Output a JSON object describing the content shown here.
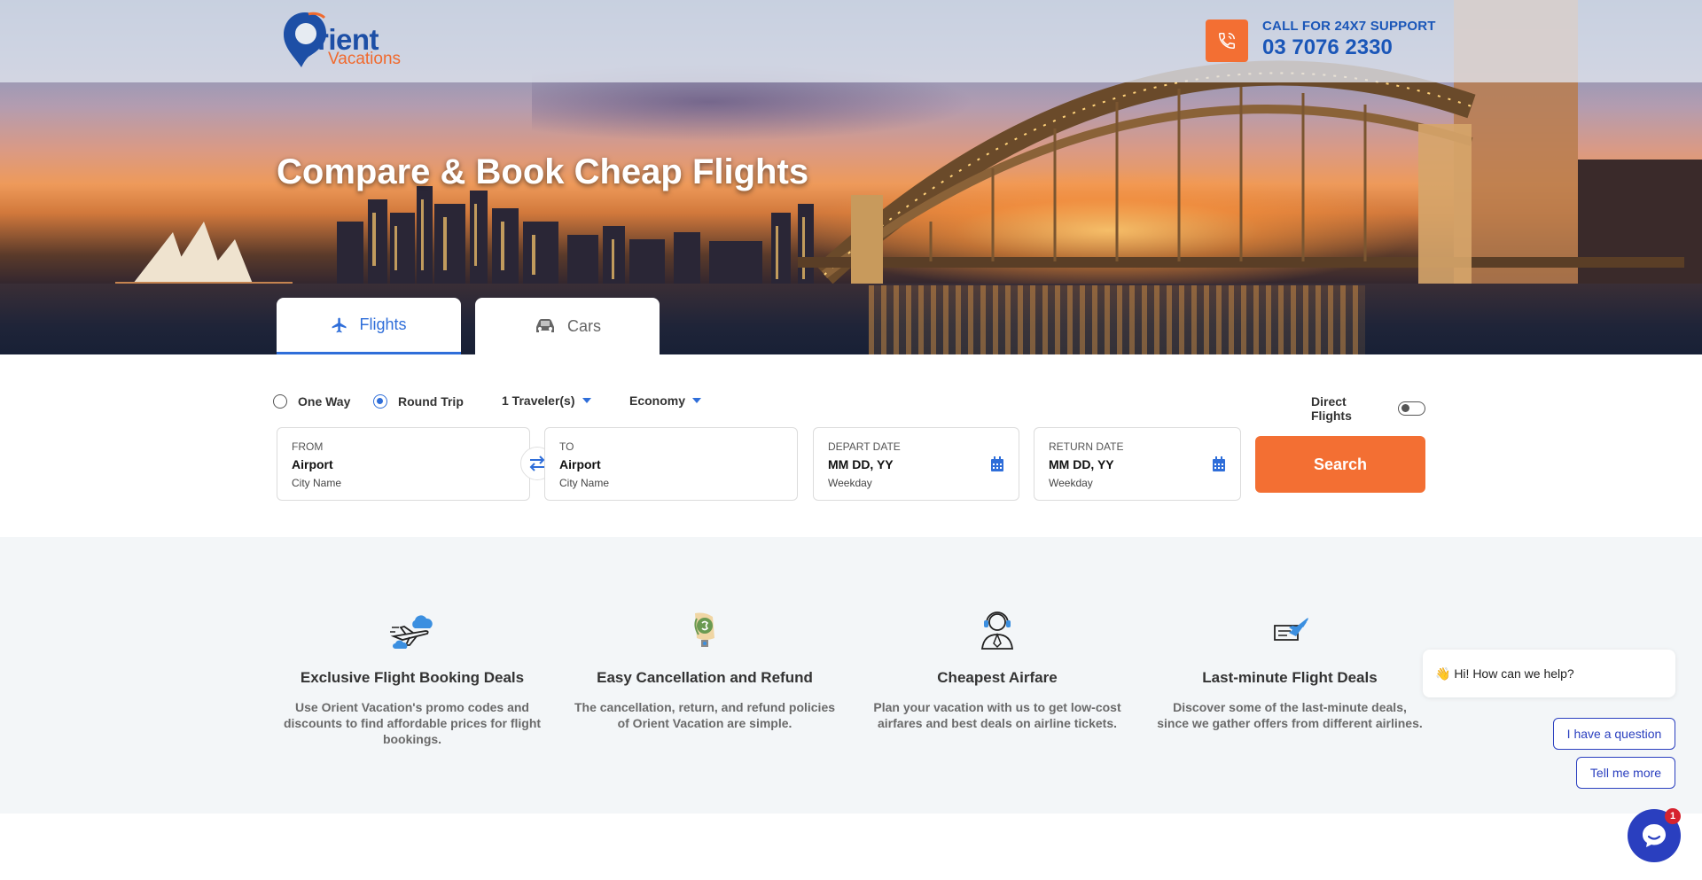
{
  "header": {
    "logo_main": "rient",
    "logo_sub": "Vacations",
    "support_label": "CALL FOR 24X7 SUPPORT",
    "support_phone": "03 7076 2330"
  },
  "hero": {
    "title": "Compare & Book Cheap Flights"
  },
  "tabs": [
    {
      "label": "Flights",
      "icon": "plane-icon",
      "active": true
    },
    {
      "label": "Cars",
      "icon": "car-icon",
      "active": false
    }
  ],
  "search": {
    "trip_types": [
      {
        "label": "One Way",
        "selected": false
      },
      {
        "label": "Round Trip",
        "selected": true
      }
    ],
    "travelers": "1 Traveler(s)",
    "cabin": "Economy",
    "direct_flights_label": "Direct Flights",
    "direct_flights_on": false,
    "from": {
      "label": "FROM",
      "value": "Airport",
      "sub": "City Name"
    },
    "to": {
      "label": "TO",
      "value": "Airport",
      "sub": "City Name"
    },
    "depart": {
      "label": "DEPART DATE",
      "value": "MM DD, YY",
      "sub": "Weekday"
    },
    "return": {
      "label": "RETURN DATE",
      "value": "MM DD, YY",
      "sub": "Weekday"
    },
    "search_label": "Search"
  },
  "features": [
    {
      "title": "Exclusive Flight Booking Deals",
      "desc": "Use Orient Vacation's promo codes and discounts to find affordable prices for flight bookings.",
      "icon": "plane-cloud-icon"
    },
    {
      "title": "Easy Cancellation and Refund",
      "desc": "The cancellation, return, and refund policies of Orient Vacation are simple.",
      "icon": "money-refund-icon"
    },
    {
      "title": "Cheapest Airfare",
      "desc": "Plan your vacation with us to get low-cost airfares and best deals on airline tickets.",
      "icon": "support-agent-icon"
    },
    {
      "title": "Last-minute Flight Deals",
      "desc": "Discover some of the last-minute deals, since we gather offers from different airlines.",
      "icon": "ticket-plane-icon"
    }
  ],
  "chat": {
    "greeting": "👋 Hi! How can we help?",
    "option_question": "I have a question",
    "option_more": "Tell me more",
    "badge_count": "1"
  },
  "colors": {
    "brand_blue": "#1a56b8",
    "accent_orange": "#f36f33",
    "chat_blue": "#2a3fbf"
  }
}
